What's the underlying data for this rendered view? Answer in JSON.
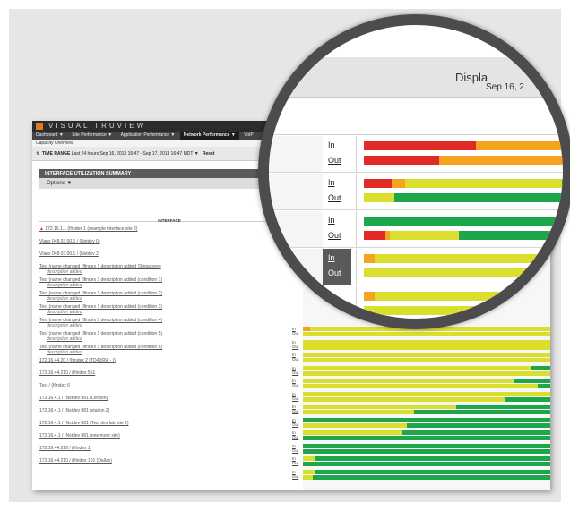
{
  "app": {
    "brand": "VISUAL TRUVIEW",
    "menu": [
      "Dashboard ▼",
      "Site Performance ▼",
      "Application Performance ▼",
      "Network Performance ▼",
      "VoIP"
    ],
    "active_menu_index": 3,
    "breadcrumb": "Capacity Overview",
    "time_range_label": "TIME RANGE",
    "time_range_value": "Last 24 hours Sep 16, 2013 16:47 - Sep 17, 2013 16:47 MDT",
    "time_range_caret": "▼",
    "reset_label": "Reset"
  },
  "summary": {
    "title": "INTERFACE UTILIZATION SUMMARY",
    "options_label": "Options ▼",
    "column_header": "INTERFACE"
  },
  "rows": [
    {
      "label": "172.16.1.1 (Ifindex 1 (example interface site 2)",
      "desc": "",
      "alert": true
    },
    {
      "label": "Vlans 048.03.00.1 / (Nstdev 0)",
      "desc": "",
      "alert": false
    },
    {
      "label": "Vlans 048.03.00.1 / (Nstdev 2",
      "desc": "",
      "alert": false
    },
    {
      "label": "Test (name changed (Ifindex 1 description added (Singapore)",
      "desc": "description added",
      "alert": false
    },
    {
      "label": "Test (name changed (Ifindex 1 description added (condition 1)",
      "desc": "description added",
      "alert": false
    },
    {
      "label": "Test (name changed (Ifindex 1 description added (condition 2)",
      "desc": "description added",
      "alert": false
    },
    {
      "label": "Test (name changed (Ifindex 1 description added (condition 3)",
      "desc": "description added",
      "alert": false
    },
    {
      "label": "Test (name changed (Ifindex 1 description added (condition 4)",
      "desc": "description added",
      "alert": false
    },
    {
      "label": "Test (name changed (Ifindex 1 description added (condition 5)",
      "desc": "description added",
      "alert": false
    },
    {
      "label": "Test (name changed (Ifindex 1 description added (condition 6)",
      "desc": "description added",
      "alert": false
    },
    {
      "label": "172.16.44.20 / (Ifindex 2 (TD4066k - I)",
      "desc": "",
      "alert": false
    },
    {
      "label": "172.16.44.210 / (Ifindex 551",
      "desc": "",
      "alert": false
    },
    {
      "label": "Test / (Ifindex 6",
      "desc": "",
      "alert": false
    },
    {
      "label": "172.16.4.1 / (Nstdev 881 (London)",
      "desc": "",
      "alert": false
    },
    {
      "label": "172.16.4.1 / (Nstdev 881 (station 2)",
      "desc": "",
      "alert": false
    },
    {
      "label": "172.16.4.1 / (Nstdev 881 (Two dev lab site 2)",
      "desc": "",
      "alert": false
    },
    {
      "label": "172.16.4.1 / (Nstdev 881 (one more site)",
      "desc": "",
      "alert": false
    },
    {
      "label": "172.16.44.210 / (Ifindex 1",
      "desc": "",
      "alert": false
    },
    {
      "label": "172.16.44.210 / (Ifindex 101 (Dallas)",
      "desc": "",
      "alert": false
    }
  ],
  "io": {
    "in": "In",
    "out": "Out"
  },
  "magnifier": {
    "title": "Displa",
    "date": "Sep 16, 2",
    "rows": [
      {
        "in_segs": [
          {
            "c": "red",
            "w": 0.52
          },
          {
            "c": "orange",
            "w": 0.48
          }
        ],
        "out_segs": [
          {
            "c": "red",
            "w": 0.35
          },
          {
            "c": "orange",
            "w": 0.65
          }
        ],
        "selected": false
      },
      {
        "in_segs": [
          {
            "c": "red",
            "w": 0.13
          },
          {
            "c": "orange",
            "w": 0.06
          },
          {
            "c": "yellow",
            "w": 0.73
          },
          {
            "c": "green",
            "w": 0.08
          }
        ],
        "out_segs": [
          {
            "c": "yellow",
            "w": 0.14
          },
          {
            "c": "green",
            "w": 0.86
          }
        ],
        "selected": false
      },
      {
        "in_segs": [
          {
            "c": "green",
            "w": 1.0
          }
        ],
        "out_segs": [
          {
            "c": "red",
            "w": 0.1
          },
          {
            "c": "orange",
            "w": 0.02
          },
          {
            "c": "yellow",
            "w": 0.32
          },
          {
            "c": "green",
            "w": 0.56
          }
        ],
        "selected": false
      },
      {
        "in_segs": [
          {
            "c": "orange",
            "w": 0.05
          },
          {
            "c": "yellow",
            "w": 0.95
          }
        ],
        "out_segs": [
          {
            "c": "yellow",
            "w": 1.0
          }
        ],
        "selected": true
      },
      {
        "in_segs": [
          {
            "c": "orange",
            "w": 0.05
          },
          {
            "c": "yellow",
            "w": 0.95
          }
        ],
        "out_segs": [
          {
            "c": "yellow",
            "w": 1.0
          }
        ],
        "selected": false
      },
      {
        "in_segs": [
          {
            "c": "orange",
            "w": 0.05
          },
          {
            "c": "yellow",
            "w": 0.95
          }
        ],
        "out_segs": [
          {
            "c": "yellow",
            "w": 1.0
          }
        ],
        "selected": false
      },
      {
        "in_segs": [
          {
            "c": "orange",
            "w": 0.05
          },
          {
            "c": "yellow",
            "w": 0.95
          }
        ],
        "out_segs": [
          {
            "c": "yellow",
            "w": 1.0
          }
        ],
        "selected": false
      }
    ]
  },
  "mini_bars": [
    {
      "in_segs": [
        {
          "c": "orange",
          "w": 0.03
        },
        {
          "c": "yellow",
          "w": 0.97
        }
      ],
      "out_segs": [
        {
          "c": "yellow",
          "w": 1.0
        }
      ]
    },
    {
      "in_segs": [
        {
          "c": "yellow",
          "w": 1.0
        }
      ],
      "out_segs": [
        {
          "c": "yellow",
          "w": 1.0
        }
      ]
    },
    {
      "in_segs": [
        {
          "c": "yellow",
          "w": 1.0
        }
      ],
      "out_segs": [
        {
          "c": "yellow",
          "w": 1.0
        }
      ]
    },
    {
      "in_segs": [
        {
          "c": "yellow",
          "w": 0.92
        },
        {
          "c": "green",
          "w": 0.08
        }
      ],
      "out_segs": [
        {
          "c": "yellow",
          "w": 1.0
        }
      ]
    },
    {
      "in_segs": [
        {
          "c": "yellow",
          "w": 0.85
        },
        {
          "c": "green",
          "w": 0.15
        }
      ],
      "out_segs": [
        {
          "c": "yellow",
          "w": 0.95
        },
        {
          "c": "green",
          "w": 0.05
        }
      ]
    },
    {
      "in_segs": [
        {
          "c": "yellow",
          "w": 1.0
        }
      ],
      "out_segs": [
        {
          "c": "yellow",
          "w": 0.82
        },
        {
          "c": "green",
          "w": 0.18
        }
      ]
    },
    {
      "in_segs": [
        {
          "c": "yellow",
          "w": 0.62
        },
        {
          "c": "green",
          "w": 0.38
        }
      ],
      "out_segs": [
        {
          "c": "yellow",
          "w": 0.45
        },
        {
          "c": "green",
          "w": 0.55
        }
      ]
    },
    {
      "in_segs": [
        {
          "c": "green",
          "w": 1.0
        }
      ],
      "out_segs": [
        {
          "c": "yellow",
          "w": 0.42
        },
        {
          "c": "green",
          "w": 0.58
        }
      ]
    },
    {
      "in_segs": [
        {
          "c": "yellow",
          "w": 0.4
        },
        {
          "c": "green",
          "w": 0.6
        }
      ],
      "out_segs": [
        {
          "c": "green",
          "w": 1.0
        }
      ]
    },
    {
      "in_segs": [
        {
          "c": "green",
          "w": 1.0
        }
      ],
      "out_segs": [
        {
          "c": "green",
          "w": 1.0
        }
      ]
    },
    {
      "in_segs": [
        {
          "c": "yellow",
          "w": 0.05
        },
        {
          "c": "green",
          "w": 0.95
        }
      ],
      "out_segs": [
        {
          "c": "green",
          "w": 1.0
        }
      ]
    },
    {
      "in_segs": [
        {
          "c": "yellow",
          "w": 0.05
        },
        {
          "c": "green",
          "w": 0.95
        }
      ],
      "out_segs": [
        {
          "c": "yellow",
          "w": 0.04
        },
        {
          "c": "green",
          "w": 0.96
        }
      ]
    }
  ],
  "colors": {
    "red": "#e12a26",
    "orange": "#f6a320",
    "yellow": "#dade2c",
    "green": "#1ea64a",
    "brand": "#e07a1f",
    "topbar": "#2b2b2d"
  }
}
